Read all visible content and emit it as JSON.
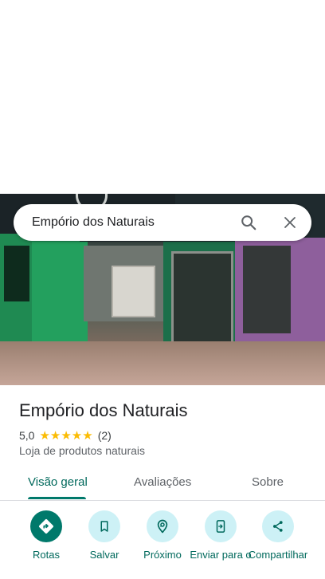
{
  "search": {
    "query": "Empório dos Naturais"
  },
  "place": {
    "name": "Empório dos Naturais",
    "rating": "5,0",
    "stars": "★★★★★",
    "review_count": "(2)",
    "category": "Loja de produtos naturais"
  },
  "tabs": [
    {
      "label": "Visão geral",
      "active": true
    },
    {
      "label": "Avaliações",
      "active": false
    },
    {
      "label": "Sobre",
      "active": false
    }
  ],
  "actions": [
    {
      "label": "Rotas",
      "icon": "directions-icon"
    },
    {
      "label": "Salvar",
      "icon": "bookmark-icon"
    },
    {
      "label": "Próximo",
      "icon": "nearby-icon"
    },
    {
      "label": "Enviar para o",
      "icon": "send-to-phone-icon"
    },
    {
      "label": "Compartilhar",
      "icon": "share-icon"
    }
  ],
  "colors": {
    "accent": "#00796b",
    "accent_text": "#00695c",
    "action_bg": "#cdf1f6",
    "star": "#fbbc04"
  }
}
